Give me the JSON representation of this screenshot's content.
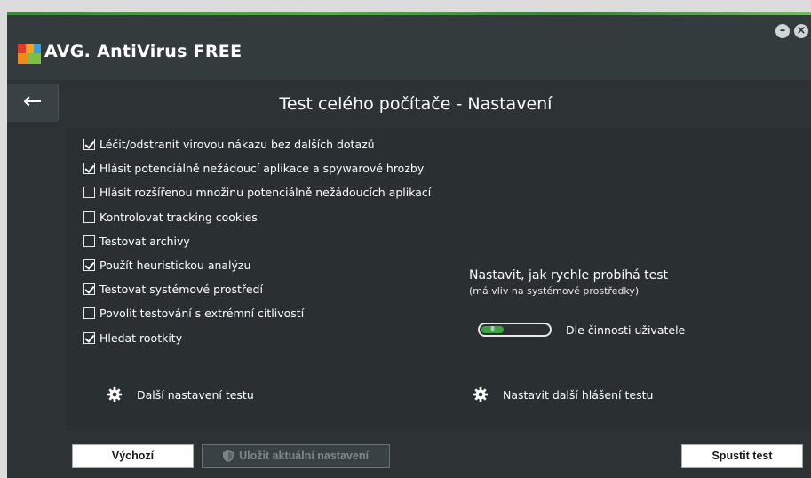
{
  "app": {
    "brand": "AVG.",
    "title": "AntiVirus FREE",
    "window_controls": {
      "minimize_icon": "minimize-icon",
      "close_icon": "close-icon"
    }
  },
  "header": {
    "back_icon": "arrow-left-icon",
    "page_title": "Test celého počítače - Nastavení"
  },
  "options": [
    {
      "label": "Léčit/odstranit virovou nákazu bez dalších dotazů",
      "checked": true
    },
    {
      "label": "Hlásit potenciálně nežádoucí aplikace a spywarové hrozby",
      "checked": true
    },
    {
      "label": "Hlásit rozšířenou množinu potenciálně nežádoucích aplikací",
      "checked": false
    },
    {
      "label": "Kontrolovat tracking cookies",
      "checked": false
    },
    {
      "label": "Testovat archivy",
      "checked": false
    },
    {
      "label": "Použít heuristickou analýzu",
      "checked": true
    },
    {
      "label": "Testovat systémové prostředí",
      "checked": true
    },
    {
      "label": "Povolit testování s extrémní citlivostí",
      "checked": false
    },
    {
      "label": "Hledat rootkity",
      "checked": true
    }
  ],
  "speed": {
    "title": "Nastavit, jak rychle probíhá test",
    "subtitle": "(má vliv na systémové prostředky)",
    "value_label": "Dle činnosti uživatele",
    "level_fraction": 0.33
  },
  "links": {
    "more_settings": "Další nastavení testu",
    "more_reports": "Nastavit další hlášení testu"
  },
  "footer": {
    "default_button": "Výchozí",
    "save_button": "Uložit aktuální nastavení",
    "start_button": "Spustit test"
  },
  "colors": {
    "background": "#2d3335",
    "accent_green": "#3fa246"
  }
}
